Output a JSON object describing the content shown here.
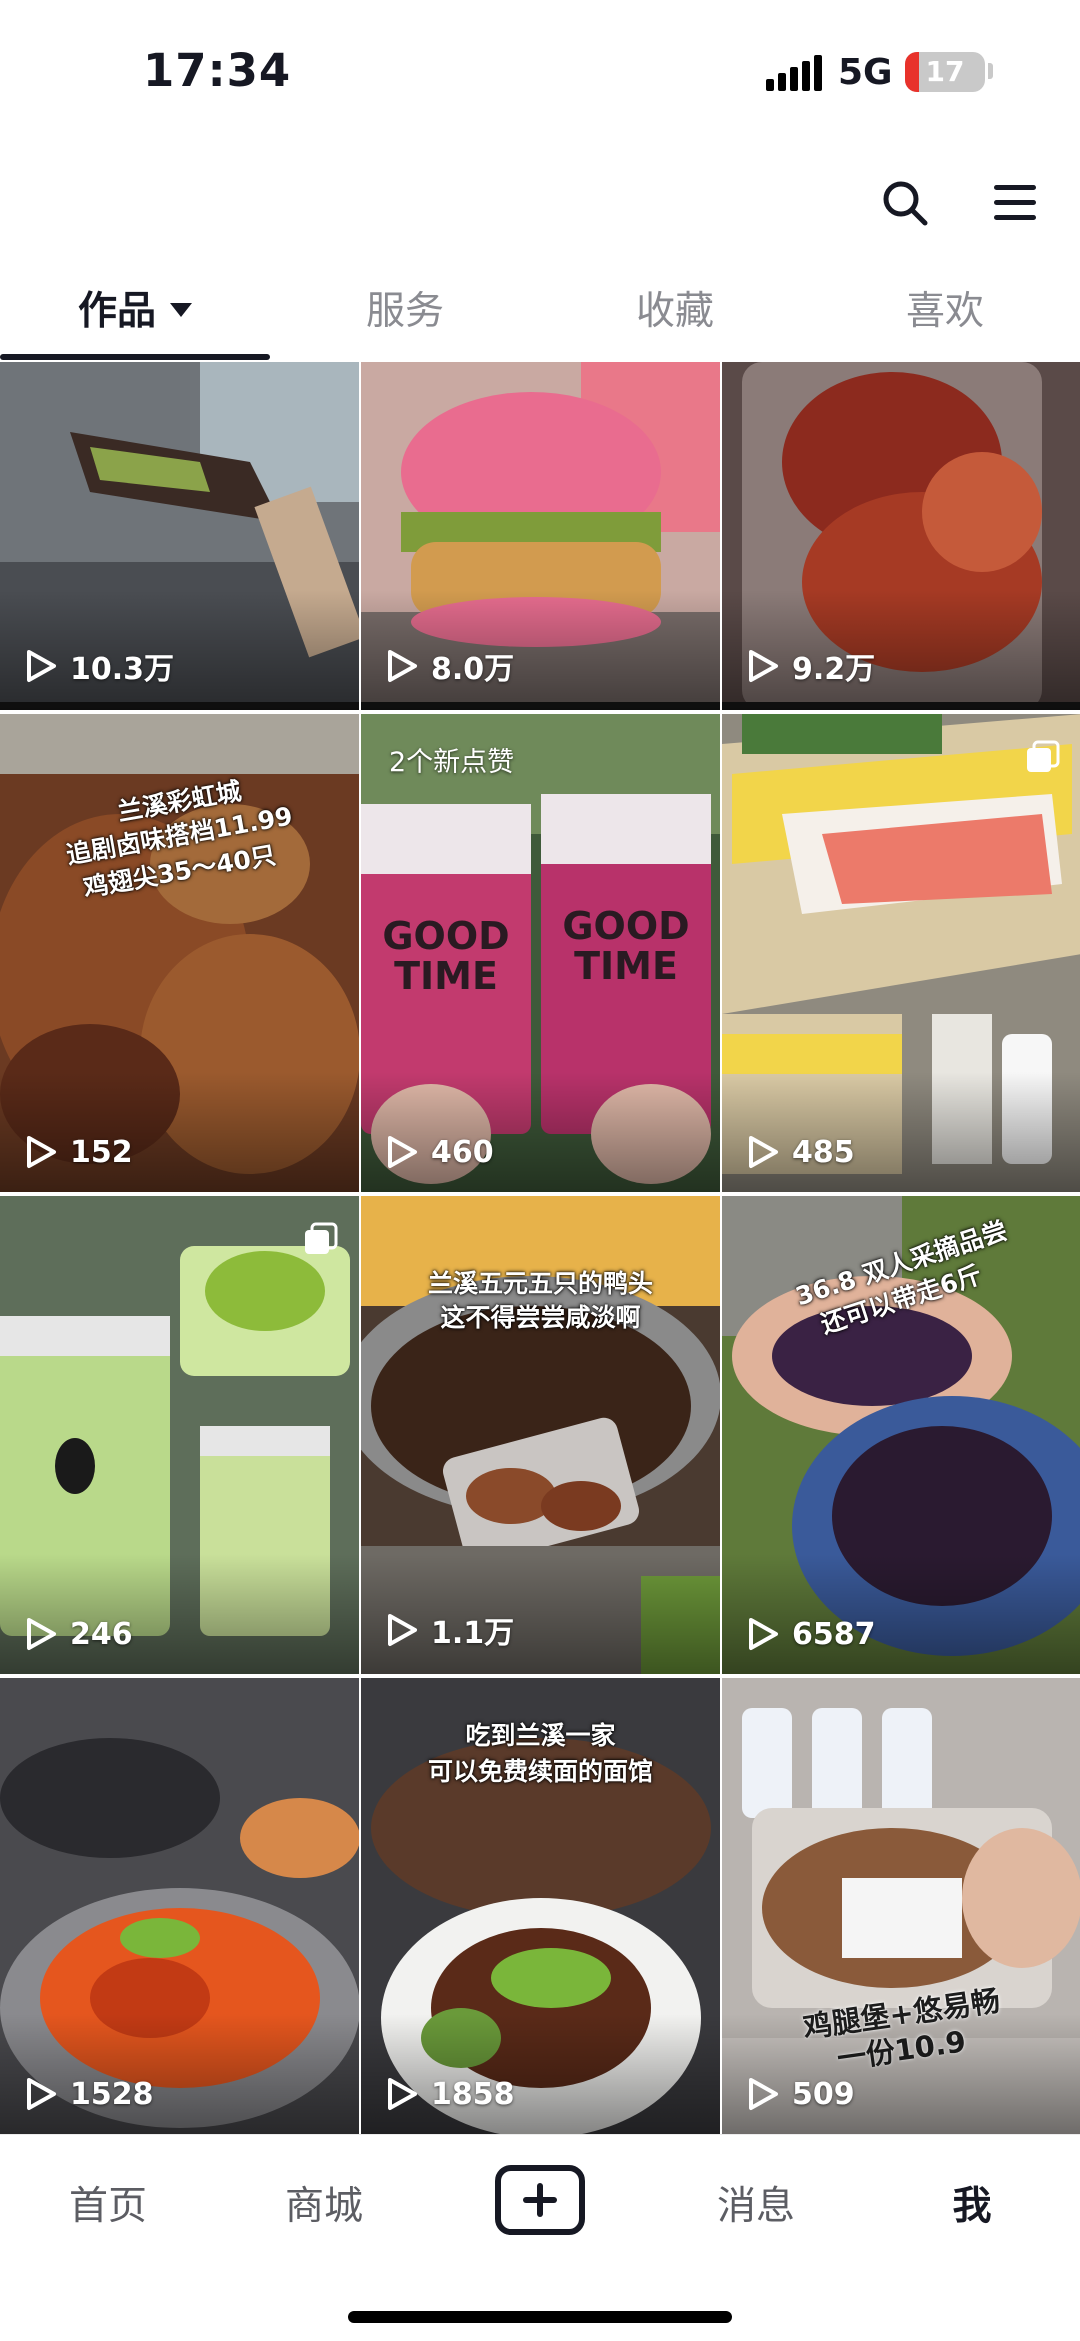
{
  "status_bar": {
    "time": "17:34",
    "network": "5G",
    "battery": "17",
    "battery_level": 0.17
  },
  "header": {
    "search_icon": "search-icon",
    "menu_icon": "menu-icon"
  },
  "tabs": [
    {
      "label": "作品",
      "active": true
    },
    {
      "label": "服务",
      "active": false
    },
    {
      "label": "收藏",
      "active": false
    },
    {
      "label": "喜欢",
      "active": false
    }
  ],
  "grid": [
    {
      "views": "10.3万"
    },
    {
      "views": "8.0万"
    },
    {
      "views": "9.2万"
    },
    {
      "views": "152",
      "caption": "兰溪彩虹城\n追剧卤味搭档11.99\n鸡翅尖35～40只"
    },
    {
      "views": "460",
      "note": "2个新点赞"
    },
    {
      "views": "485",
      "multi_image": true
    },
    {
      "views": "246",
      "multi_image": true
    },
    {
      "views": "1.1万",
      "caption": "兰溪五元五只的鸭头\n这不得尝尝咸淡啊"
    },
    {
      "views": "6587",
      "caption": "36.8 双人采摘品尝\n还可以带走6斤"
    },
    {
      "views": "1528"
    },
    {
      "views": "1858",
      "caption": "吃到兰溪一家\n可以免费续面的面馆"
    },
    {
      "views": "509",
      "caption": "鸡腿堡+悠易畅\n一份10.9"
    }
  ],
  "bottom_nav": [
    {
      "label": "首页",
      "active": false
    },
    {
      "label": "商城",
      "active": false
    },
    {
      "label": "+",
      "active": false,
      "icon": "add-icon"
    },
    {
      "label": "消息",
      "active": false
    },
    {
      "label": "我",
      "active": true
    }
  ]
}
